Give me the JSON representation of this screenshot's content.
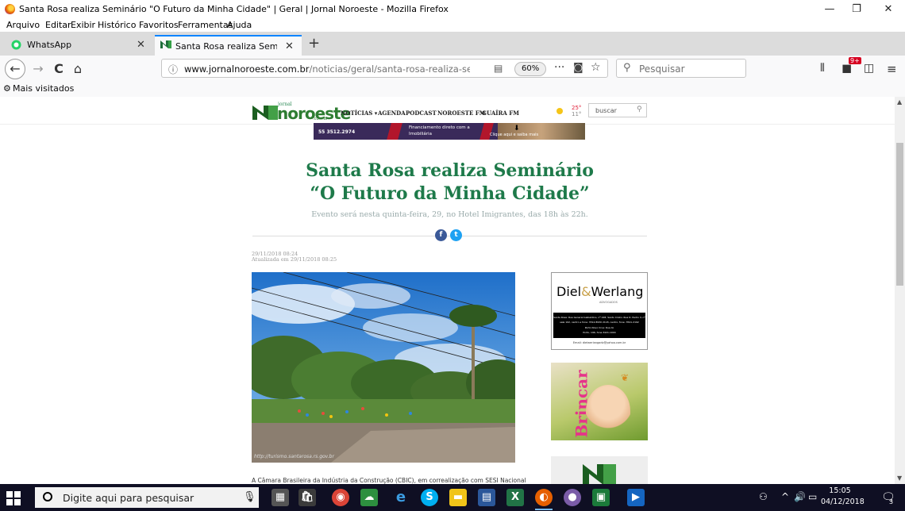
{
  "window": {
    "title": "Santa Rosa realiza Seminário \"O Futuro da Minha Cidade\" | Geral | Jornal Noroeste - Mozilla Firefox",
    "minimize": "—",
    "maximize": "❐",
    "close": "✕"
  },
  "menu": [
    "Arquivo",
    "Editar",
    "Exibir",
    "Histórico",
    "Favoritos",
    "Ferramentas",
    "Ajuda"
  ],
  "tabs": [
    {
      "label": "WhatsApp",
      "close": "✕"
    },
    {
      "label": "Santa Rosa realiza Seminário \"O",
      "close": "✕"
    }
  ],
  "newtab": "+",
  "nav": {
    "back": "←",
    "forward": "→",
    "reload": "C",
    "home": "⌂",
    "url_host": "www.jornalnoroeste.com.br",
    "url_path": "/noticias/geral/santa-rosa-realiza-seminario",
    "zoom": "60%",
    "more": "···",
    "search_placeholder": "Pesquisar",
    "badge": "9+"
  },
  "bookmarks": {
    "label": "Mais visitados"
  },
  "site": {
    "logo_small": "jornal",
    "logo": "noroeste",
    "logo_suffix": ".com.br",
    "nav_links": [
      "NOTÍCIAS ▾",
      "AGENDA",
      "PODCAST",
      "NOROESTE FM",
      "GUAÍRA FM"
    ],
    "temp_hi": "25°",
    "temp_lo": "11°",
    "search_placeholder": "buscar"
  },
  "ad_banner": {
    "phone": "55 3512.2974",
    "line1": "Financiamento direto com a",
    "line2": "Imobiliária",
    "cta": "Clique aqui e saiba mais"
  },
  "article": {
    "headline_1": "Santa Rosa realiza Seminário",
    "headline_2": "“O Futuro da Minha Cidade”",
    "subtitle": "Evento será nesta quinta-feira, 29, no Hotel Imigrantes, das 18h às 22h.",
    "published": "29/11/2018 08:24",
    "updated": "Atualizada em 29/11/2018 08:25",
    "photo_credit": "http://turismo.santarosa.rs.gov.br",
    "body_start": "A Câmara Brasileira da Indústria da Construção (CBIC), em correalização com SESI Nacional"
  },
  "side_ads": {
    "diel_name_1": "Diel",
    "diel_amp": "&",
    "diel_name_2": "Werlang",
    "diel_sub": "ADVOGADOS",
    "diel_line1": "Santa Rosa: Rua General Gaibaldino, nº 228,  Santo Cristo: Rua D. Pedro II, nº",
    "diel_line2": "sala 102, centro e fone: 3512.8930       2118, centro, fone: 3541.2192",
    "diel_line3": "Porto Novo Crus: Rua do",
    "diel_line4": "Porto, 196, fone 3421-1004",
    "diel_email": "Email: dielwerlangadv@yahoo.com.br",
    "brincar": "Brincar"
  },
  "taskbar": {
    "search_placeholder": "Digite aqui para pesquisar",
    "time": "15:05",
    "date": "04/12/2018",
    "notif_count": "3"
  }
}
